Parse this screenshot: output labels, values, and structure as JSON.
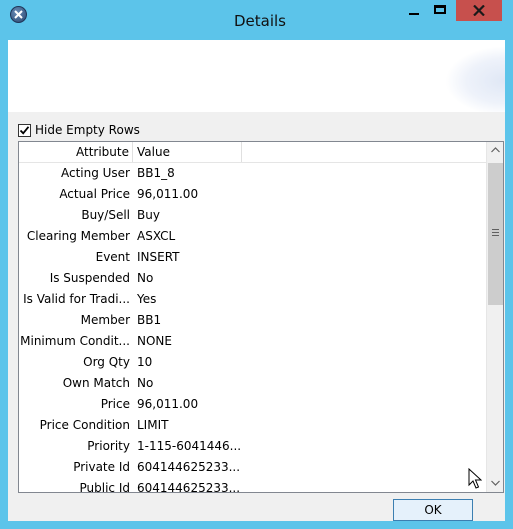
{
  "window": {
    "title": "Details",
    "icon": "app-logo-icon",
    "accent_color": "#5cc4ea",
    "close_color": "#c7504d"
  },
  "options": {
    "hide_empty_rows_label": "Hide Empty Rows",
    "hide_empty_rows_checked": true
  },
  "grid": {
    "columns": [
      "Attribute",
      "Value"
    ],
    "rows": [
      {
        "attribute": "Acting User",
        "value": "BB1_8"
      },
      {
        "attribute": "Actual Price",
        "value": "96,011.00"
      },
      {
        "attribute": "Buy/Sell",
        "value": "Buy"
      },
      {
        "attribute": "Clearing Member",
        "value": "ASXCL"
      },
      {
        "attribute": "Event",
        "value": "INSERT"
      },
      {
        "attribute": "Is Suspended",
        "value": "No"
      },
      {
        "attribute": "Is Valid for Tradi...",
        "value": "Yes"
      },
      {
        "attribute": "Member",
        "value": "BB1"
      },
      {
        "attribute": "Minimum Condit...",
        "value": "NONE"
      },
      {
        "attribute": "Org Qty",
        "value": "10"
      },
      {
        "attribute": "Own Match",
        "value": "No"
      },
      {
        "attribute": "Price",
        "value": "96,011.00"
      },
      {
        "attribute": "Price Condition",
        "value": "LIMIT"
      },
      {
        "attribute": "Priority",
        "value": "1-115-6041446..."
      },
      {
        "attribute": "Private Id",
        "value": "604144625233..."
      },
      {
        "attribute": "Public Id",
        "value": "604144625233..."
      }
    ]
  },
  "footer": {
    "ok_label": "OK"
  }
}
